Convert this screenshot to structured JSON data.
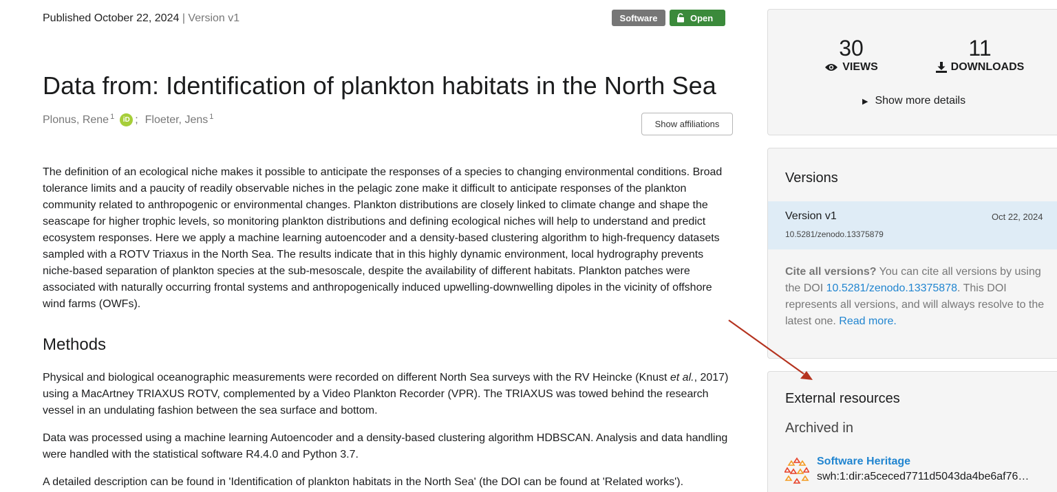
{
  "record": {
    "published": "Published October 22, 2024",
    "separator": "|",
    "version": "Version v1",
    "badges": {
      "software": "Software",
      "open": "Open"
    },
    "title": "Data from: Identification of plankton habitats in the North Sea",
    "authors": [
      {
        "name": "Plonus, Rene",
        "affiliation": "1",
        "orcid": "iD"
      },
      {
        "name": "Floeter, Jens",
        "affiliation": "1"
      }
    ],
    "author_separator": ";",
    "show_affiliations": "Show affiliations"
  },
  "description": {
    "paragraph": "The definition of an ecological niche makes it possible to anticipate the responses of a species to changing environmental conditions. Broad tolerance limits and a paucity of readily observable niches in the pelagic zone make it difficult to anticipate responses of the plankton community related to anthropogenic or environmental changes. Plankton distributions are closely linked to climate change and shape the seascape for higher trophic levels, so monitoring plankton distributions and defining ecological niches will help to understand and predict ecosystem responses. Here we apply a machine learning autoencoder and a density-based clustering algorithm to high-frequency datasets sampled with a ROTV Triaxus in the North Sea. The results indicate that in this highly dynamic environment, local hydrography prevents niche-based separation of plankton species at the sub-mesoscale, despite the availability of different habitats. Plankton patches were associated with naturally occurring frontal systems and anthropogenically induced upwelling-downwelling dipoles in the vicinity of offshore wind farms (OWFs)."
  },
  "methods": {
    "heading": "Methods",
    "p1_before": "Physical and biological oceanographic measurements were recorded on different North Sea surveys with the RV Heincke (Knust ",
    "p1_italic": "et al.",
    "p1_after": ", 2017) using a MacArtney TRIAXUS ROTV, complemented by a Video Plankton Recorder (VPR). The TRIAXUS was towed behind the research vessel in an undulating fashion between the sea surface and bottom.",
    "p2": "Data was processed using a machine learning Autoencoder and a density-based clustering algorithm HDBSCAN. Analysis and data handling were handled with the statistical software R4.4.0 and Python 3.7.",
    "p3": "A detailed description can be found in 'Identification of plankton habitats in the North Sea' (the DOI can be found at 'Related works')."
  },
  "sidebar": {
    "views": {
      "count": "30",
      "label": "VIEWS",
      "icon": "eye-icon"
    },
    "downloads": {
      "count": "11",
      "label": "DOWNLOADS",
      "icon": "download-icon"
    },
    "show_more": "Show more details",
    "versions": {
      "heading": "Versions",
      "items": [
        {
          "name": "Version v1",
          "date": "Oct 22, 2024",
          "doi": "10.5281/zenodo.13375879"
        }
      ],
      "cite_bold": "Cite all versions?",
      "cite_text1": " You can cite all versions by using the DOI ",
      "cite_doi": "10.5281/zenodo.13375878",
      "cite_text2": ". This DOI represents all versions, and will always resolve to the latest one. ",
      "read_more": "Read more."
    },
    "external": {
      "heading": "External resources",
      "archived": "Archived in",
      "resource_name": "Software Heritage",
      "resource_id": "swh:1:dir:a5ceced7711d5043da4be6af76…"
    }
  },
  "colors": {
    "software_badge": "#767676",
    "open_badge": "#3b8a3b",
    "link": "#2185d0",
    "version_highlight": "#dfecf6",
    "annotation_arrow": "#b5331f"
  }
}
